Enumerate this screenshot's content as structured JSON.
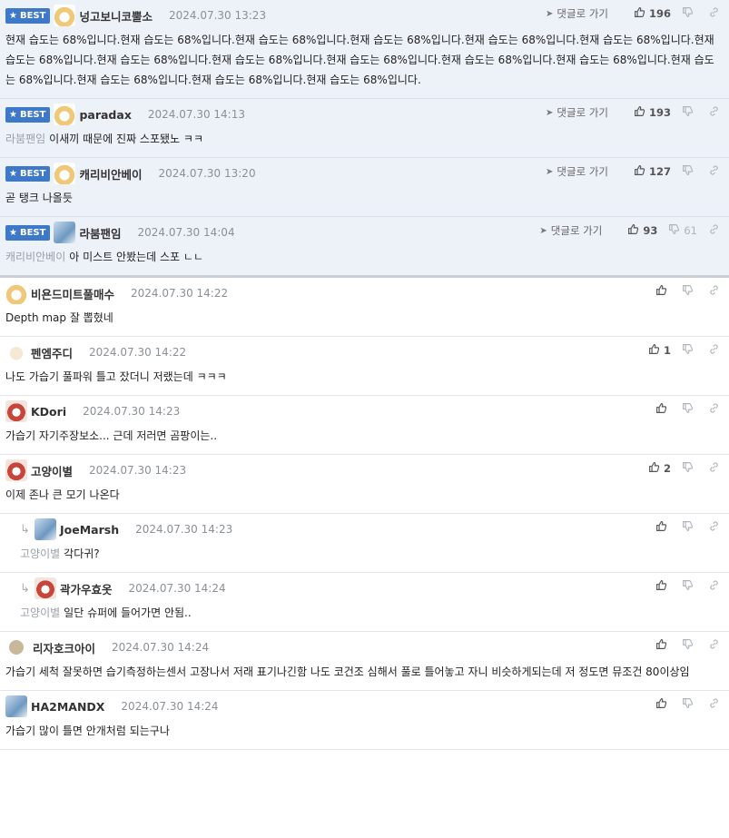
{
  "labels": {
    "best": "BEST",
    "goto": "댓글로 가기"
  },
  "colors": {
    "best_badge": "#3e78c8",
    "best_bg": "#edf1f8"
  },
  "comments": [
    {
      "best": true,
      "avatar": "dog",
      "nick": "넝고보니코뿔소",
      "date": "2024.07.30 13:23",
      "goto": true,
      "likes": "196",
      "dislikes": "",
      "mention": "",
      "text": "현재 습도는 68%입니다.현재 습도는 68%입니다.현재 습도는 68%입니다.현재 습도는 68%입니다.현재 습도는 68%입니다.현재 습도는 68%입니다.현재 습도는 68%입니다.현재 습도는 68%입니다.현재 습도는 68%입니다.현재 습도는 68%입니다.현재 습도는 68%입니다.현재 습도는 68%입니다.현재 습도는 68%입니다.현재 습도는 68%입니다.현재 습도는 68%입니다.현재 습도는 68%입니다."
    },
    {
      "best": true,
      "avatar": "dog",
      "nick": "paradax",
      "date": "2024.07.30 14:13",
      "goto": true,
      "likes": "193",
      "dislikes": "",
      "mention": "라붐팬임",
      "text": "이새끼 때문에 진짜 스포됐노 ㅋㅋ"
    },
    {
      "best": true,
      "avatar": "dog",
      "nick": "캐리비안베이",
      "date": "2024.07.30 13:20",
      "goto": true,
      "likes": "127",
      "dislikes": "",
      "mention": "",
      "text": "곧 탱크 나올듯"
    },
    {
      "best": true,
      "avatar": "blue",
      "nick": "라붐팬임",
      "date": "2024.07.30 14:04",
      "goto": true,
      "likes": "93",
      "dislikes": "61",
      "mention": "캐리비안베이",
      "text": "아 미스트 안봤는데 스포 ㄴㄴ"
    },
    {
      "best": false,
      "avatar": "dog",
      "nick": "비욘드미트풀매수",
      "date": "2024.07.30 14:22",
      "goto": false,
      "likes": "",
      "dislikes": "",
      "mention": "",
      "text": "Depth map 잘 뽑혔네"
    },
    {
      "best": false,
      "avatar": "pale",
      "nick": "펜엠주디",
      "date": "2024.07.30 14:22",
      "goto": false,
      "likes": "1",
      "dislikes": "",
      "mention": "",
      "text": "나도 가습기 풀파워 틀고 잤더니 저랬는데 ㅋㅋㅋ"
    },
    {
      "best": false,
      "avatar": "red",
      "nick": "KDori",
      "date": "2024.07.30 14:23",
      "goto": false,
      "likes": "",
      "dislikes": "",
      "mention": "",
      "text": "가습기 자기주장보소... 근데 저러면 곰팡이는.."
    },
    {
      "best": false,
      "avatar": "red",
      "nick": "고양이별",
      "date": "2024.07.30 14:23",
      "goto": false,
      "likes": "2",
      "dislikes": "",
      "mention": "",
      "text": "이제 존나 큰 모기 나온다"
    },
    {
      "best": false,
      "reply": true,
      "avatar": "blue",
      "nick": "JoeMarsh",
      "date": "2024.07.30 14:23",
      "goto": false,
      "likes": "",
      "dislikes": "",
      "mention": "고양이별",
      "text": "각다귀?"
    },
    {
      "best": false,
      "reply": true,
      "avatar": "red",
      "nick": "곽가우효옷",
      "date": "2024.07.30 14:24",
      "goto": false,
      "likes": "",
      "dislikes": "",
      "mention": "고양이별",
      "text": "일단 슈퍼에 들어가면 안됨.."
    },
    {
      "best": false,
      "avatar": "dot",
      "nick": "리자호크아이",
      "date": "2024.07.30 14:24",
      "goto": false,
      "likes": "",
      "dislikes": "",
      "mention": "",
      "text": "가습기 세척 잘못하면 습기측정하는센서 고장나서 저래 표기나긴함 나도 코건조 심해서 풀로 틀어놓고 자니 비슷하게되는데 저 정도면 뮤조건 80이상임"
    },
    {
      "best": false,
      "avatar": "blue",
      "nick": "HA2MANDX",
      "date": "2024.07.30 14:24",
      "goto": false,
      "likes": "",
      "dislikes": "",
      "mention": "",
      "text": "가습기 많이 틀면 안개처럼 되는구나"
    }
  ]
}
